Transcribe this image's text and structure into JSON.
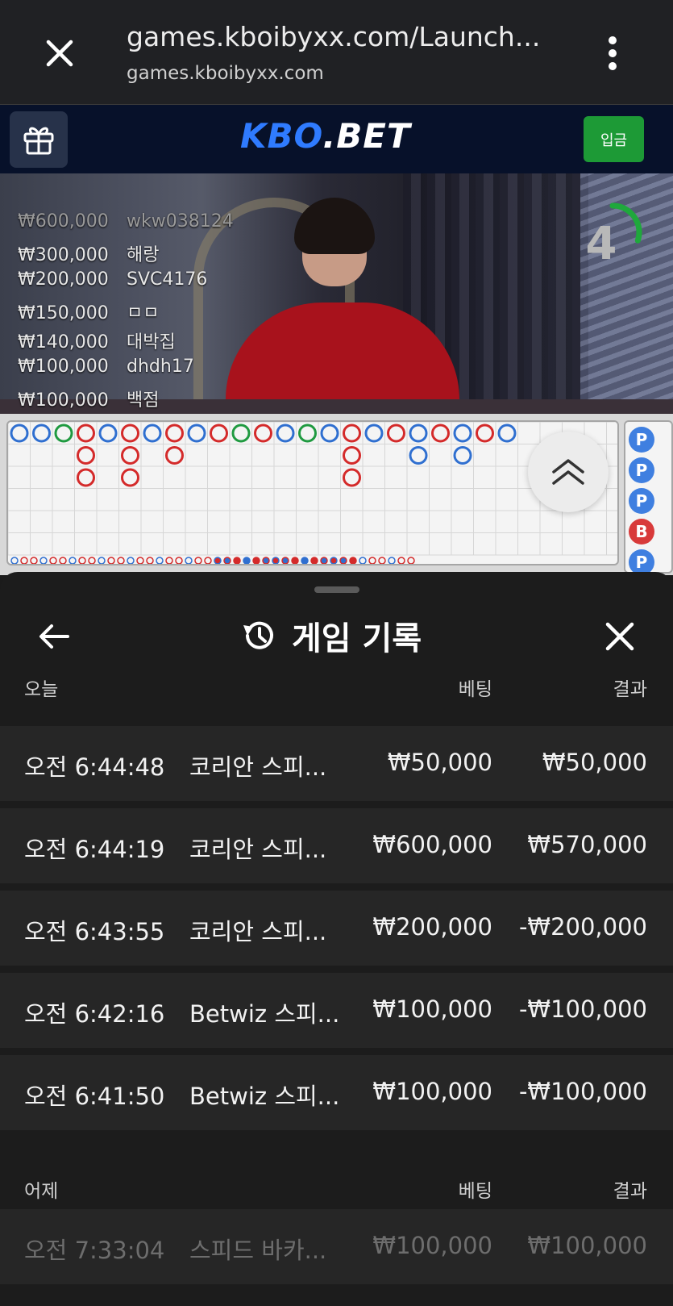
{
  "browser": {
    "title": "games.kboibyxx.com/Launch...",
    "url": "games.kboibyxx.com"
  },
  "header": {
    "logo_kbo": "KBO",
    "logo_bet": ".BET",
    "deposit_label": "입금"
  },
  "video": {
    "countdown": "4",
    "countdown_fraction": 0.3,
    "bets": [
      {
        "amount": "₩600,000",
        "user": "wkw038124"
      },
      {
        "amount": "₩300,000",
        "user": "해랑"
      },
      {
        "amount": "₩200,000",
        "user": "SVC4176"
      },
      {
        "amount": "₩150,000",
        "user": "ㅁㅁ"
      },
      {
        "amount": "₩140,000",
        "user": "대박집"
      },
      {
        "amount": "₩100,000",
        "user": "dhdh17"
      },
      {
        "amount": "₩100,000",
        "user": "백점"
      }
    ]
  },
  "roadmap": {
    "side_labels": [
      "P",
      "P",
      "P",
      "B",
      "P"
    ],
    "colors": {
      "player": "#2f6fd0",
      "banker": "#d42a2a",
      "tie": "#1f9a40"
    }
  },
  "sheet": {
    "title": "게임 기록",
    "today": {
      "label": "오늘",
      "bet_header": "베팅",
      "result_header": "결과",
      "rows": [
        {
          "time": "오전 6:44:48",
          "game": "코리안 스피...",
          "bet": "₩50,000",
          "result": "₩50,000"
        },
        {
          "time": "오전 6:44:19",
          "game": "코리안 스피...",
          "bet": "₩600,000",
          "result": "₩570,000"
        },
        {
          "time": "오전 6:43:55",
          "game": "코리안 스피...",
          "bet": "₩200,000",
          "result": "-₩200,000"
        },
        {
          "time": "오전 6:42:16",
          "game": "Betwiz 스피...",
          "bet": "₩100,000",
          "result": "-₩100,000"
        },
        {
          "time": "오전 6:41:50",
          "game": "Betwiz 스피...",
          "bet": "₩100,000",
          "result": "-₩100,000"
        }
      ]
    },
    "yesterday": {
      "label": "어제",
      "bet_header": "베팅",
      "result_header": "결과",
      "rows": [
        {
          "time": "오전 7:33:04",
          "game": "스피드 바카...",
          "bet": "₩100,000",
          "result": "₩100,000"
        }
      ]
    }
  }
}
